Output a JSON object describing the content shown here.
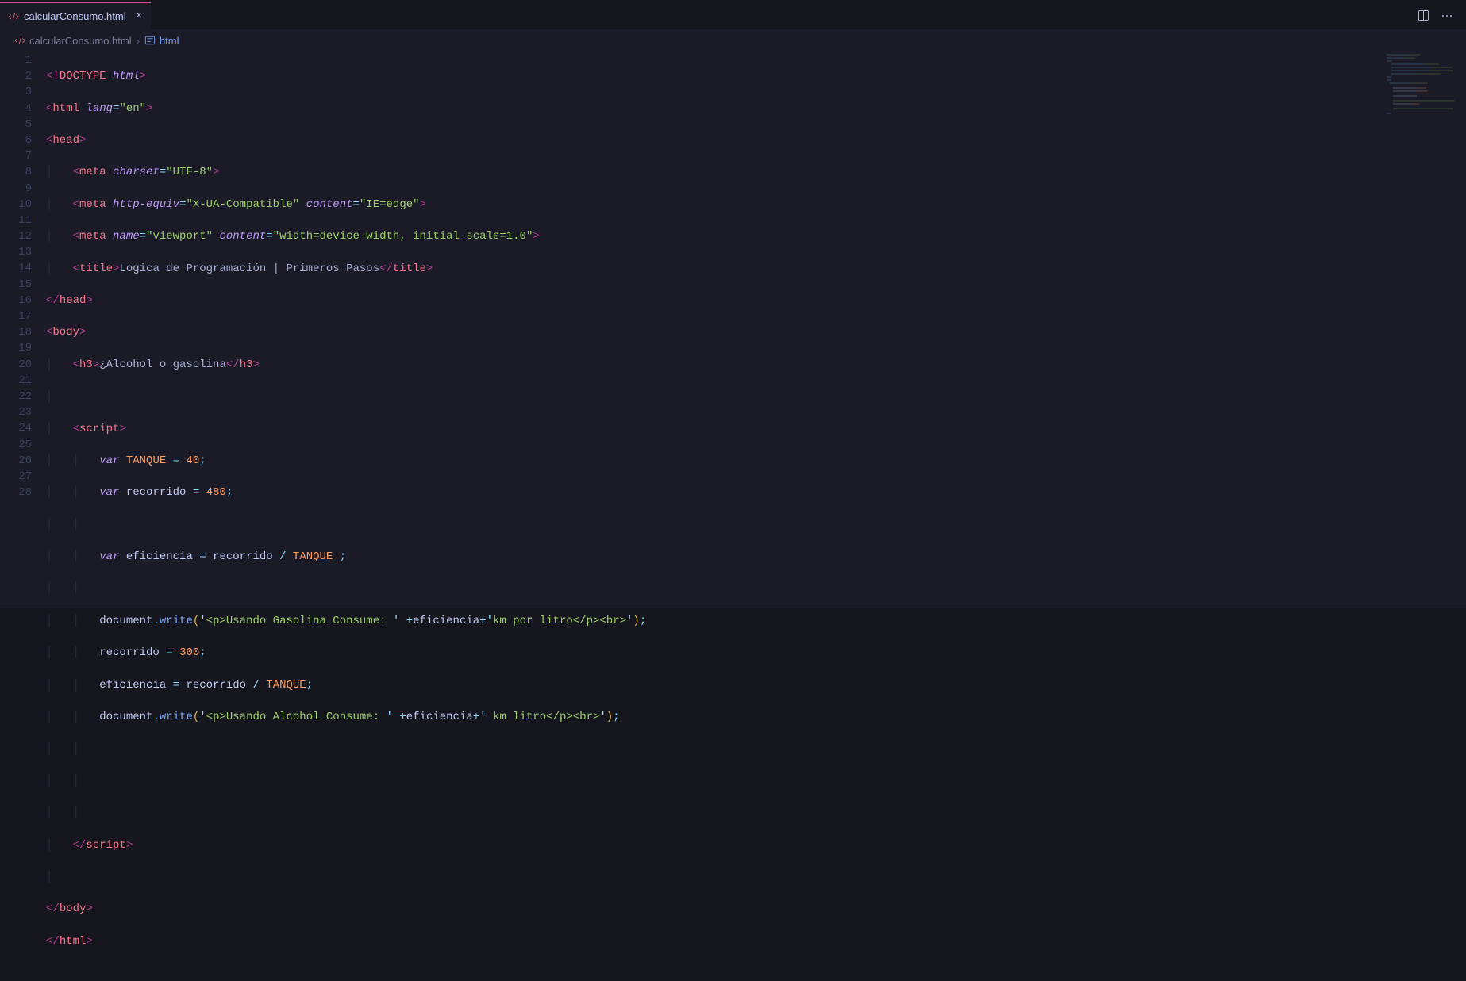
{
  "tab": {
    "filename": "calcularConsumo.html"
  },
  "breadcrumb": {
    "file": "calcularConsumo.html",
    "element": "html"
  },
  "gutter": [
    "1",
    "2",
    "3",
    "4",
    "5",
    "6",
    "7",
    "8",
    "9",
    "10",
    "11",
    "12",
    "13",
    "14",
    "15",
    "16",
    "17",
    "18",
    "19",
    "20",
    "21",
    "22",
    "23",
    "24",
    "25",
    "26",
    "27",
    "28"
  ],
  "code": {
    "l1": {
      "t1": "<!",
      "t2": "DOCTYPE ",
      "t3": "html",
      "t4": ">"
    },
    "l2": {
      "t1": "<",
      "t2": "html ",
      "t3": "lang",
      "t4": "=",
      "t5": "\"en\"",
      "t6": ">"
    },
    "l3": {
      "t1": "<",
      "t2": "head",
      "t3": ">"
    },
    "l4": {
      "t1": "<",
      "t2": "meta ",
      "t3": "charset",
      "t4": "=",
      "t5": "\"UTF-8\"",
      "t6": ">"
    },
    "l5": {
      "t1": "<",
      "t2": "meta ",
      "t3": "http-equiv",
      "t4": "=",
      "t5": "\"X-UA-Compatible\"",
      "t6": " ",
      "t7": "content",
      "t8": "=",
      "t9": "\"IE=edge\"",
      "t10": ">"
    },
    "l6": {
      "t1": "<",
      "t2": "meta ",
      "t3": "name",
      "t4": "=",
      "t5": "\"viewport\"",
      "t6": " ",
      "t7": "content",
      "t8": "=",
      "t9": "\"width=device-width, initial-scale=1.0\"",
      "t10": ">"
    },
    "l7": {
      "t1": "<",
      "t2": "title",
      "t3": ">",
      "t4": "Logica de Programación | Primeros Pasos",
      "t5": "</",
      "t6": "title",
      "t7": ">"
    },
    "l8": {
      "t1": "</",
      "t2": "head",
      "t3": ">"
    },
    "l9": {
      "t1": "<",
      "t2": "body",
      "t3": ">"
    },
    "l10": {
      "t1": "<",
      "t2": "h3",
      "t3": ">",
      "t4": "¿Alcohol o gasolina",
      "t5": "</",
      "t6": "h3",
      "t7": ">"
    },
    "l12": {
      "t1": "<",
      "t2": "script",
      "t3": ">"
    },
    "l13": {
      "t1": "var",
      "t2": " ",
      "t3": "TANQUE",
      "t4": " ",
      "t5": "=",
      "t6": " ",
      "t7": "40",
      "t8": ";"
    },
    "l14": {
      "t1": "var",
      "t2": " ",
      "t3": "recorrido",
      "t4": " ",
      "t5": "=",
      "t6": " ",
      "t7": "480",
      "t8": ";"
    },
    "l16": {
      "t1": "var",
      "t2": " ",
      "t3": "eficiencia",
      "t4": " ",
      "t5": "=",
      "t6": " ",
      "t7": "recorrido",
      "t8": " ",
      "t9": "/",
      "t10": " ",
      "t11": "TANQUE",
      "t12": " ;"
    },
    "l18": {
      "t1": "document",
      "t2": ".",
      "t3": "write",
      "t4": "(",
      "t5": "'",
      "t6": "<p>Usando Gasolina Consume: ",
      "t7": "'",
      "t8": " ",
      "t9": "+",
      "t10": "eficiencia",
      "t11": "+",
      "t12": "'",
      "t13": "km por litro</p><br>",
      "t14": "'",
      "t15": ")",
      "t16": ";"
    },
    "l19": {
      "t1": "recorrido",
      "t2": " ",
      "t3": "=",
      "t4": " ",
      "t5": "300",
      "t6": ";"
    },
    "l20": {
      "t1": "eficiencia",
      "t2": " ",
      "t3": "=",
      "t4": " ",
      "t5": "recorrido",
      "t6": " ",
      "t7": "/",
      "t8": " ",
      "t9": "TANQUE",
      "t10": ";"
    },
    "l21": {
      "t1": "document",
      "t2": ".",
      "t3": "write",
      "t4": "(",
      "t5": "'",
      "t6": "<p>Usando Alcohol Consume: ",
      "t7": "'",
      "t8": " ",
      "t9": "+",
      "t10": "eficiencia",
      "t11": "+",
      "t12": "'",
      "t13": " km litro</p><br>",
      "t14": "'",
      "t15": ")",
      "t16": ";"
    },
    "l25": {
      "t1": "</",
      "t2": "script",
      "t3": ">"
    },
    "l27": {
      "t1": "</",
      "t2": "body",
      "t3": ">"
    },
    "l28": {
      "t1": "</",
      "t2": "html",
      "t3": ">"
    }
  }
}
